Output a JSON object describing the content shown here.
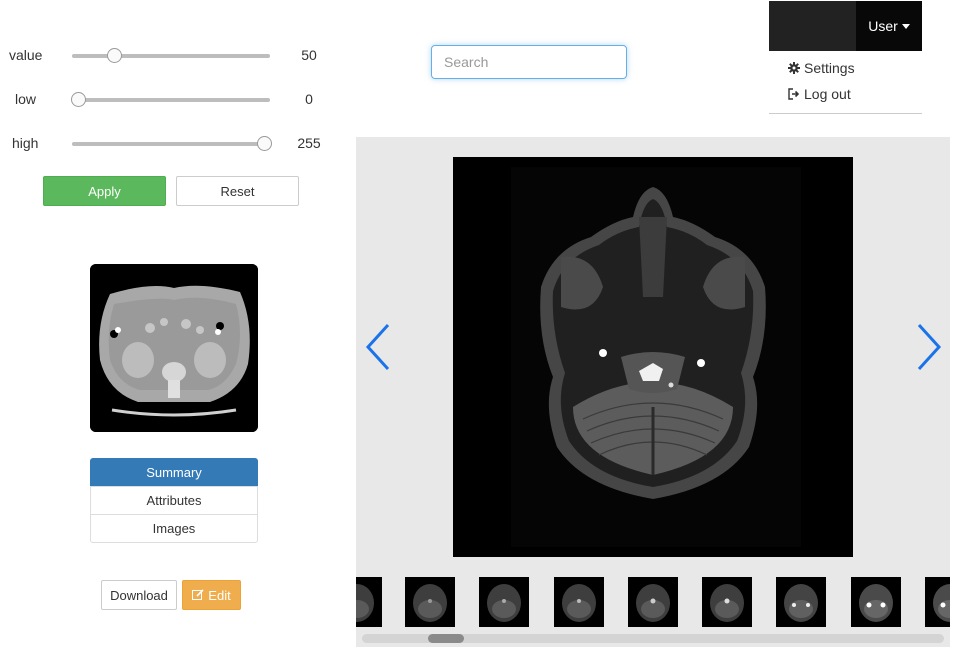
{
  "sliders": [
    {
      "label": "value",
      "value": "50",
      "fraction": 0.196
    },
    {
      "label": "low",
      "value": "0",
      "fraction": 0.0
    },
    {
      "label": "high",
      "value": "255",
      "fraction": 1.0
    }
  ],
  "buttons": {
    "apply": "Apply",
    "reset": "Reset",
    "download": "Download",
    "edit": "Edit"
  },
  "list_group": {
    "items": [
      {
        "label": "Summary",
        "active": true
      },
      {
        "label": "Attributes",
        "active": false
      },
      {
        "label": "Images",
        "active": false
      }
    ]
  },
  "search": {
    "placeholder": "Search",
    "value": ""
  },
  "user_menu": {
    "toggle_label": "User",
    "items": [
      {
        "label": "Settings",
        "icon": "gear-icon"
      },
      {
        "label": "Log out",
        "icon": "sign-out-icon"
      }
    ]
  },
  "viewer": {
    "prev_icon": "chevron-left-icon",
    "next_icon": "chevron-right-icon",
    "filmstrip_count": 9
  },
  "colors": {
    "apply": "#5cb85c",
    "edit": "#f0ad4e",
    "active": "#337ab7",
    "arrow": "#1a73e8",
    "navbar": "#222222"
  }
}
